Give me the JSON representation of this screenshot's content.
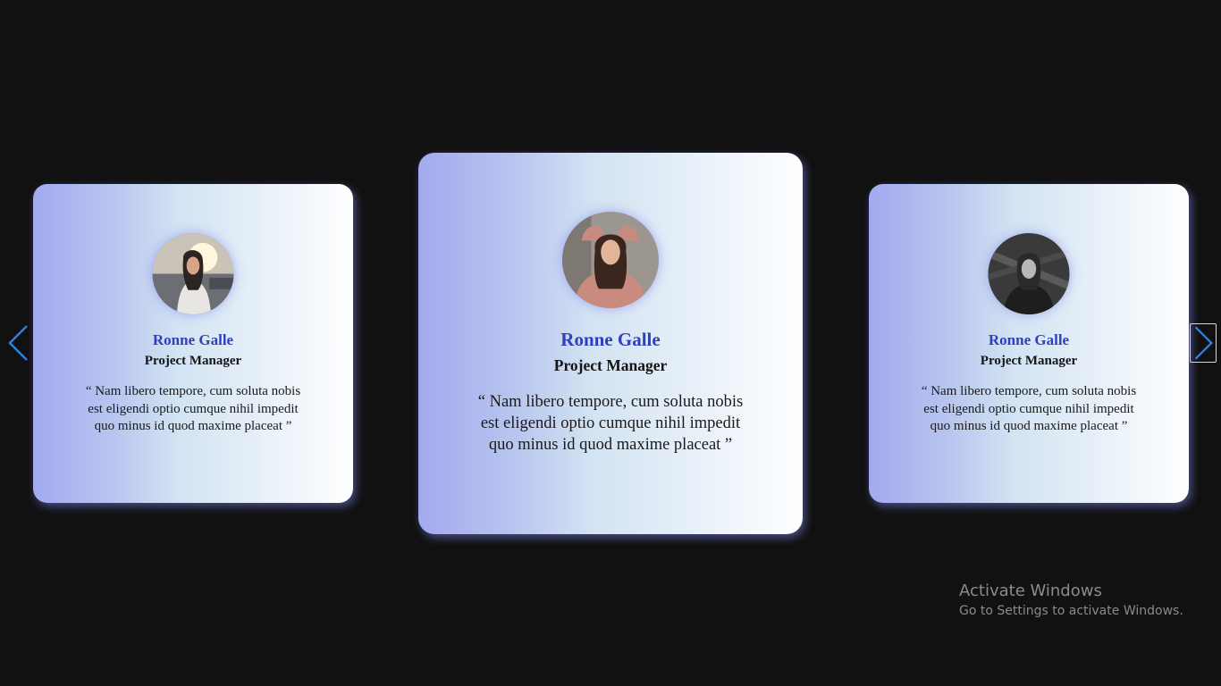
{
  "colors": {
    "background": "#111112",
    "name": "#2f3fbf",
    "arrow": "#2f7de0"
  },
  "testimonials": [
    {
      "name": "Ronne Galle",
      "role": "Project Manager",
      "quote": "“ Nam libero tempore, cum soluta nobis est eligendi optio cumque nihil impedit quo minus id quod maxime placeat ”",
      "avatar": "woman-street-sunlight-photo"
    },
    {
      "name": "Ronne Galle",
      "role": "Project Manager",
      "quote": "“ Nam libero tempore, cum soluta nobis est eligendi optio cumque nihil impedit quo minus id quod maxime placeat ”",
      "avatar": "woman-pink-sweater-photo"
    },
    {
      "name": "Ronne Galle",
      "role": "Project Manager",
      "quote": "“ Nam libero tempore, cum soluta nobis est eligendi optio cumque nihil impedit quo minus id quod maxime placeat ”",
      "avatar": "woman-black-white-photo"
    }
  ],
  "navigation": {
    "prev_icon": "chevron-left-icon",
    "next_icon": "chevron-right-icon"
  },
  "watermark": {
    "title": "Activate Windows",
    "subtitle": "Go to Settings to activate Windows."
  }
}
